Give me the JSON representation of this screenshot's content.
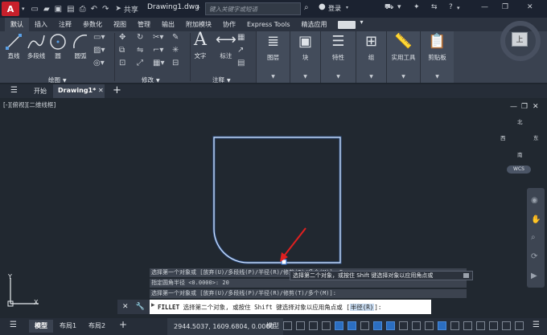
{
  "app": {
    "logo_letter": "A",
    "share_label": "共享",
    "document_title": "Drawing1.dwg",
    "search_placeholder": "键入关键字或短语",
    "login_label": "登录"
  },
  "ribbon_tabs": [
    "默认",
    "插入",
    "注释",
    "参数化",
    "视图",
    "管理",
    "输出",
    "附加模块",
    "协作",
    "Express Tools",
    "精选应用"
  ],
  "ribbon": {
    "draw_tools": [
      "直线",
      "多段线",
      "圆",
      "圆弧"
    ],
    "draw_panel_label": "绘图",
    "modify_panel_label": "修改",
    "text_tool": "文字",
    "dimension_tool": "标注",
    "annotation_panel_label": "注释",
    "big_panels": [
      "图层",
      "块",
      "特性",
      "组",
      "实用工具",
      "剪贴板"
    ]
  },
  "file_tabs": {
    "start_label": "开始",
    "drawing_label": "Drawing1*"
  },
  "viewport": {
    "label": "[-][俯视][二维线框]",
    "viewcube_face": "上",
    "compass": {
      "north": "北",
      "south": "南",
      "east": "东",
      "west": "西"
    },
    "wcs_label": "WCS",
    "ucs_y": "Y",
    "ucs_x": "X"
  },
  "command": {
    "history": [
      "选择第一个对象或 [放弃(U)/多段线(P)/半径(R)/修剪(T)/多个(M)]: R",
      "指定圆角半径 <0.0000>: 20",
      "选择第一个对象或 [放弃(U)/多段线(P)/半径(R)/修剪(T)/多个(M)]:"
    ],
    "tooltip": "选择第二个对象，或按住 Shift 键选择对象以应用角点或",
    "prompt_cmd": "FILLET",
    "prompt_text": "选择第二个对象, 或按住 Shift 键选择对象以应用角点或 [",
    "prompt_option": "半径(R)",
    "prompt_end": "]:"
  },
  "status": {
    "model_tab": "模型",
    "layout1": "布局1",
    "layout2": "布局2",
    "coordinates": "2944.5037, 1609.6804, 0.0000",
    "mode_label": "模型"
  }
}
